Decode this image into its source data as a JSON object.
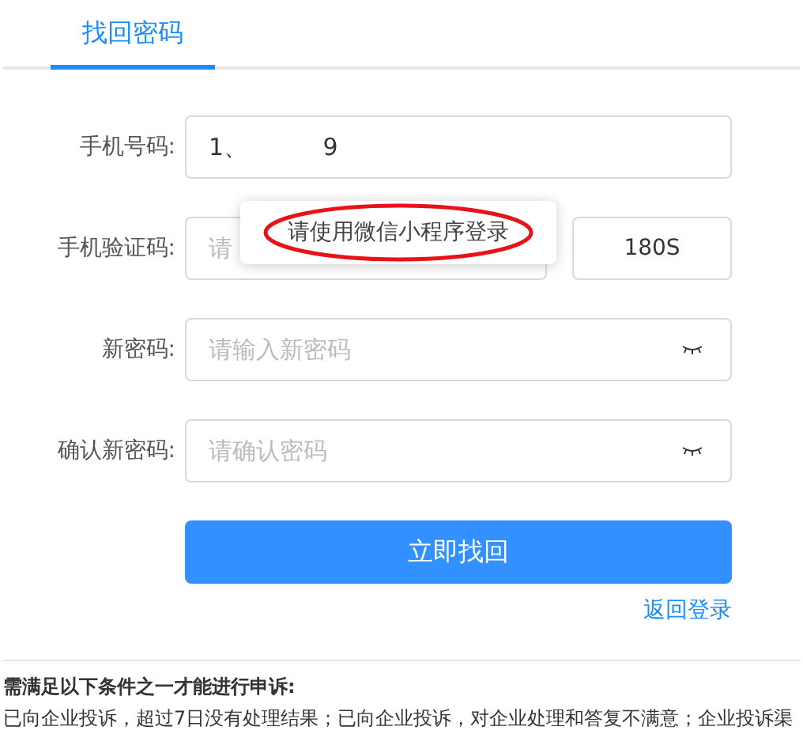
{
  "tabs": [
    {
      "label": "找回密码",
      "selected": true
    }
  ],
  "form": {
    "fields": [
      {
        "kind": "text",
        "label": "手机号码:",
        "value": "1、          9"
      },
      {
        "kind": "code",
        "label": "手机验证码:",
        "placeholder": "请",
        "countdown": "180S"
      },
      {
        "kind": "password",
        "label": "新密码:",
        "placeholder": "请输入新密码"
      },
      {
        "kind": "password",
        "label": "确认新密码:",
        "placeholder": "请确认密码"
      }
    ],
    "submit": "立即找回",
    "back_link": "返回登录"
  },
  "tooltip": {
    "text": "请使用微信小程序登录"
  },
  "notice": {
    "title": "需满足以下条件之一才能进行申诉:",
    "body": "已向企业投诉，超过7日没有处理结果；已向企业投诉，对企业处理和答复不满意；企业投诉渠"
  }
}
